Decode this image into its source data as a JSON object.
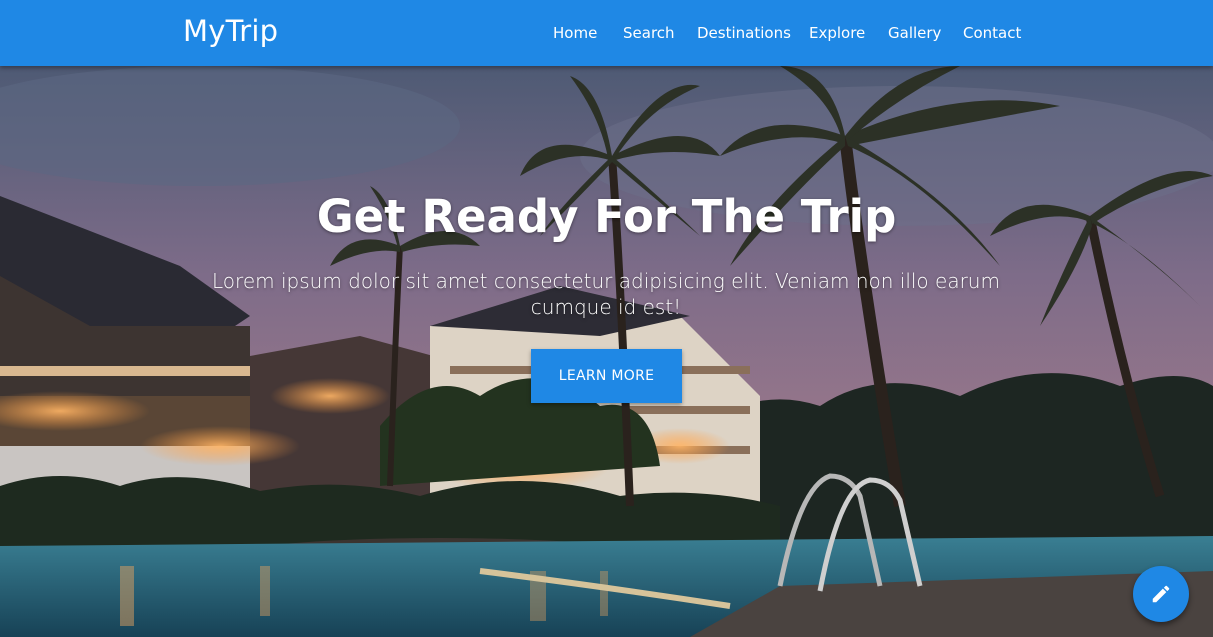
{
  "brand": {
    "name": "MyTrip"
  },
  "nav": {
    "items": [
      {
        "label": "Home"
      },
      {
        "label": "Search"
      },
      {
        "label": "Destinations"
      },
      {
        "label": "Explore"
      },
      {
        "label": "Gallery"
      },
      {
        "label": "Contact"
      }
    ]
  },
  "hero": {
    "title": "Get Ready For The Trip",
    "subtitle": "Lorem ipsum dolor sit amet consectetur adipisicing elit. Veniam non illo earum cumque id est!",
    "cta_label": "LEARN MORE",
    "background_image": "resort-pool-palm-trees-dusk"
  },
  "fab": {
    "icon": "pencil-icon"
  },
  "colors": {
    "primary": "#1f88e5",
    "text": "#ffffff"
  }
}
